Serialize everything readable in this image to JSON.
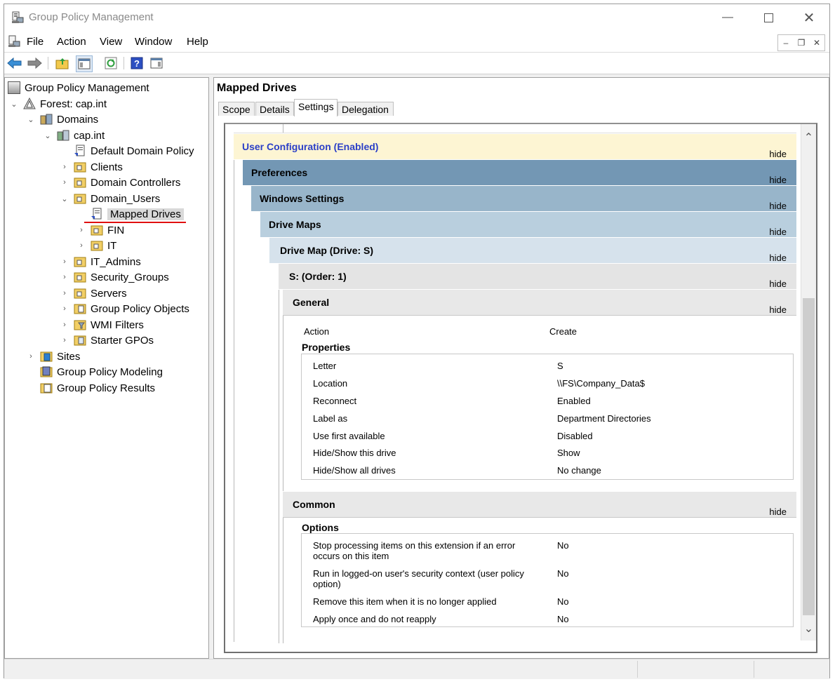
{
  "window": {
    "title": "Group Policy Management"
  },
  "menu": [
    "File",
    "Action",
    "View",
    "Window",
    "Help"
  ],
  "tree": {
    "root": "Group Policy Management",
    "forest": "Forest: cap.int",
    "domains": "Domains",
    "domain": "cap.int",
    "default_policy": "Default Domain Policy",
    "clients": "Clients",
    "domain_controllers": "Domain Controllers",
    "domain_users": "Domain_Users",
    "mapped_drives": "Mapped Drives",
    "fin": "FIN",
    "it": "IT",
    "it_admins": "IT_Admins",
    "security_groups": "Security_Groups",
    "servers": "Servers",
    "gpo": "Group Policy Objects",
    "wmi": "WMI Filters",
    "starter": "Starter GPOs",
    "sites": "Sites",
    "modeling": "Group Policy Modeling",
    "results": "Group Policy Results"
  },
  "right": {
    "title": "Mapped Drives",
    "tabs": [
      "Scope",
      "Details",
      "Settings",
      "Delegation"
    ],
    "active_tab": "Settings"
  },
  "report": {
    "hide_label": "hide",
    "user_config": "User Configuration (Enabled)",
    "preferences": "Preferences",
    "windows_settings": "Windows Settings",
    "drive_maps": "Drive Maps",
    "drive_map": "Drive Map (Drive: S)",
    "order": "S: (Order: 1)",
    "general": "General",
    "action_label": "Action",
    "action_value": "Create",
    "properties": "Properties",
    "props": [
      {
        "k": "Letter",
        "v": "S"
      },
      {
        "k": "Location",
        "v": "\\\\FS\\Company_Data$"
      },
      {
        "k": "Reconnect",
        "v": "Enabled"
      },
      {
        "k": "Label as",
        "v": "Department Directories"
      },
      {
        "k": "Use first available",
        "v": "Disabled"
      },
      {
        "k": "Hide/Show this drive",
        "v": "Show"
      },
      {
        "k": "Hide/Show all drives",
        "v": "No change"
      }
    ],
    "common": "Common",
    "options": "Options",
    "opts": [
      {
        "k": "Stop processing items on this extension if an error occurs on this item",
        "v": "No"
      },
      {
        "k": "Run in logged-on user's security context (user policy option)",
        "v": "No"
      },
      {
        "k": "Remove this item when it is no longer applied",
        "v": "No"
      },
      {
        "k": "Apply once and do not reapply",
        "v": "No"
      }
    ]
  },
  "colors": {
    "user_config_bg": "#fdf5d3",
    "user_config_text": "#2b3fc7",
    "preferences_bg": "#7397b4",
    "windows_settings_bg": "#98b5ca",
    "drive_maps_bg": "#b9cfde",
    "drive_map_bg": "#d6e2ec",
    "order_bg": "#e4e4e4",
    "selection_underline": "#e01010"
  }
}
